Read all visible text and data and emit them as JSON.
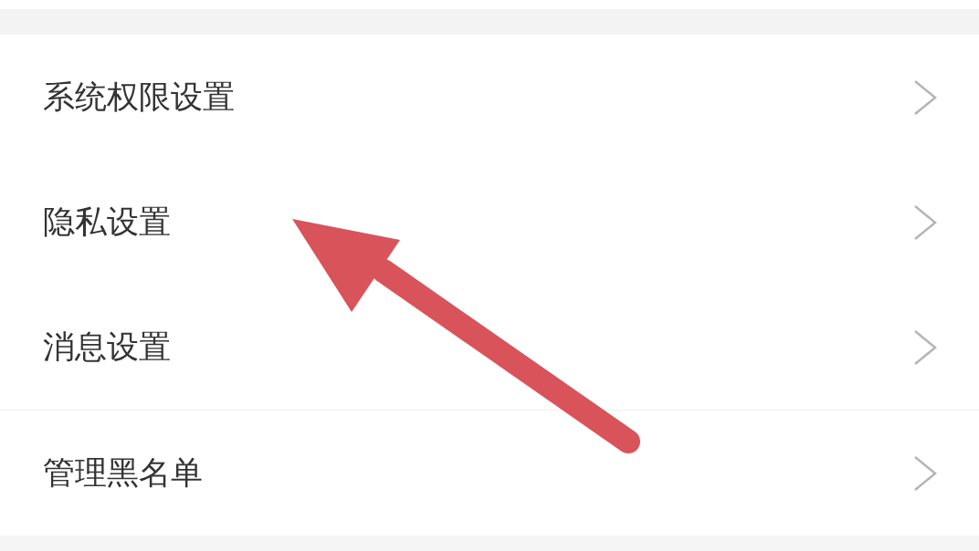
{
  "sections": [
    {
      "items": [
        {
          "label": "系统权限设置"
        },
        {
          "label": "隐私设置"
        },
        {
          "label": "消息设置"
        }
      ]
    },
    {
      "items": [
        {
          "label": "管理黑名单"
        }
      ]
    }
  ]
}
